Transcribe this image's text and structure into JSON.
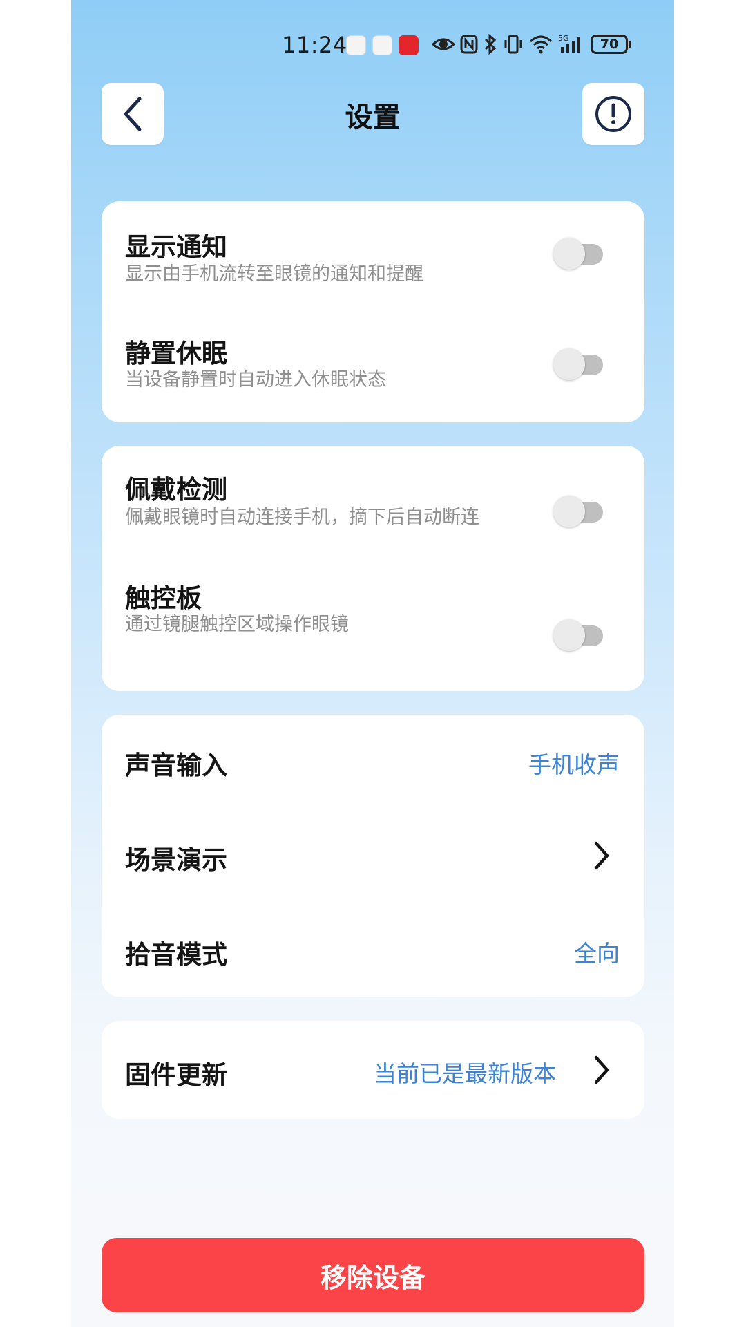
{
  "status_bar": {
    "time": "11:24",
    "battery": "70",
    "icons": [
      "huawei-appgallery-icon",
      "huawei-appgallery-icon",
      "audio-app-icon",
      "eye-icon",
      "nfc-icon",
      "bluetooth-icon",
      "vibrate-icon",
      "wifi-icon",
      "5g-signal-icon",
      "battery-icon"
    ]
  },
  "header": {
    "title": "设置",
    "back_icon": "chevron-left-icon",
    "info_icon": "exclamation-circle-icon"
  },
  "settings": {
    "show_notifications": {
      "title": "显示通知",
      "subtitle": "显示由手机流转至眼镜的通知和提醒",
      "enabled": false
    },
    "static_sleep": {
      "title": "静置休眠",
      "subtitle": "当设备静置时自动进入休眠状态",
      "enabled": false
    },
    "wear_detection": {
      "title": "佩戴检测",
      "subtitle": "佩戴眼镜时自动连接手机，摘下后自动断连",
      "enabled": false
    },
    "touchpad": {
      "title": "触控板",
      "subtitle": "通过镜腿触控区域操作眼镜",
      "enabled": false
    },
    "sound_input": {
      "title": "声音输入",
      "value": "手机收声"
    },
    "scene_demo": {
      "title": "场景演示"
    },
    "pickup_mode": {
      "title": "拾音模式",
      "value": "全向"
    },
    "firmware_update": {
      "title": "固件更新",
      "value": "当前已是最新版本"
    }
  },
  "actions": {
    "remove_device": "移除设备"
  },
  "colors": {
    "accent": "#3b83d6",
    "danger": "#fb4448",
    "toggle_off_track": "#bfbfbf"
  }
}
